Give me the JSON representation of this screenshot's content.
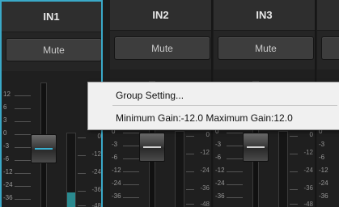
{
  "channels": [
    {
      "name": "IN1",
      "mute_label": "Mute",
      "selected": true,
      "meter_level": 0.22
    },
    {
      "name": "IN2",
      "mute_label": "Mute",
      "selected": false,
      "meter_level": 0
    },
    {
      "name": "IN3",
      "mute_label": "Mute",
      "selected": false,
      "meter_level": 0
    },
    {
      "name": "",
      "mute_label": "",
      "selected": false,
      "meter_level": 0
    }
  ],
  "fader_scale_labels": [
    "12",
    "6",
    "3",
    "0",
    "-3",
    "-6",
    "-12",
    "-24",
    "-36"
  ],
  "meter_scale_labels": [
    "0",
    "-12",
    "-24",
    "-36",
    "-48"
  ],
  "context_menu": {
    "items": [
      {
        "label": "Group Setting..."
      },
      {
        "label": "Minimum Gain:-12.0 Maximum Gain:12.0"
      }
    ]
  },
  "colors": {
    "accent": "#3aa9c8",
    "meter": "#2a8a8f",
    "menu_bg": "#f0f0f0"
  }
}
